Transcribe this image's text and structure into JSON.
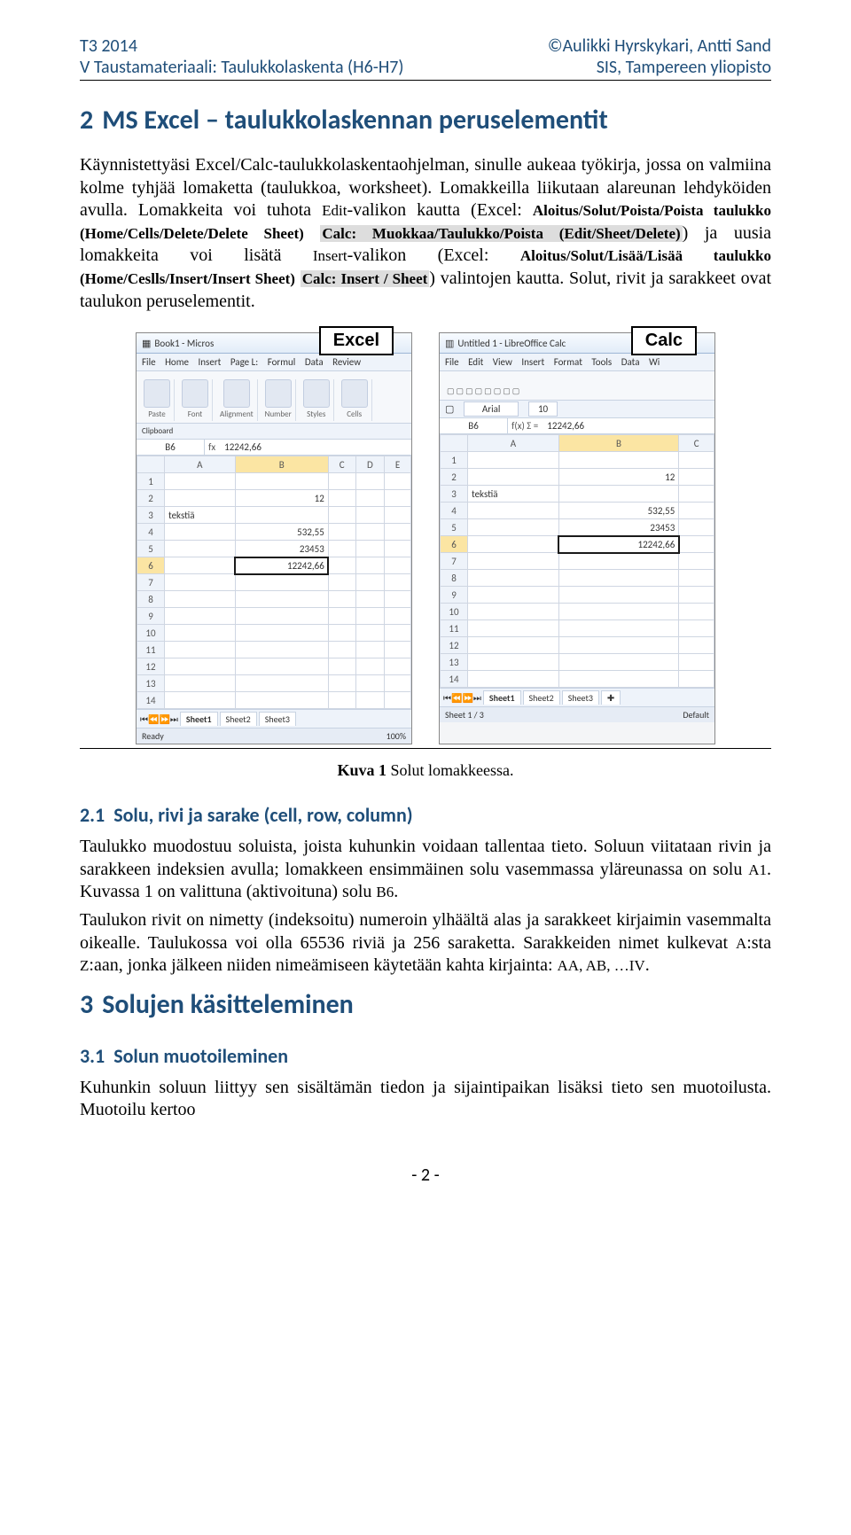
{
  "header": {
    "left1": "T3 2014",
    "left2": "V Taustamateriaali: Taulukkolaskenta (H6-H7)",
    "right1": "©Aulikki Hyrskykari, Antti Sand",
    "right2": "SIS, Tampereen yliopisto"
  },
  "section2": {
    "num": "2",
    "title": "MS Excel – taulukkolaskennan peruselementit",
    "p1a": "Käynnistettyäsi Excel/Calc-taulukkolaskentaohjelman, sinulle aukeaa työkirja, jossa on valmiina kolme tyhjää lomaketta (ta",
    "p1b": "ulukkoa, worksheet",
    "p1c": "). Lomakkeilla liikutaan alareunan lehdyköiden avulla. Lomakkeita voi tuhota ",
    "p1_edit": "Edit",
    "p1d": "-valikon kautta (Excel: ",
    "p1_small1": "Aloitus/Solut/Poista/Poista taulukko (Home/Cells/Delete/Delete Sheet)",
    "p1_hl1": "Calc: Muokkaa/Taulukko/Poista (Edit/Sheet/Delete)",
    "p1e": ") ja uusia lomakkeita voi lisätä ",
    "p1_insert": "Insert",
    "p1f": "-valikon (Excel: ",
    "p1_small2": "Aloitus/Solut/Lisää/Lisää taulukko (Home/Ceslls/Insert/Insert Sheet)",
    "p1_hl2": "Calc: Insert / Sheet",
    "p1g": ") valintojen kautta.  Solut, rivit ja sarakkeet ovat taulukon peruselementit."
  },
  "figure": {
    "excel": {
      "label": "Excel",
      "title": "Book1 - Micros",
      "tabs": [
        "File",
        "Home",
        "Insert",
        "Page L:",
        "Formul",
        "Data",
        "Review"
      ],
      "ribbonGroups": [
        "Paste",
        "Font",
        "Alignment",
        "Number",
        "Styles",
        "Cells"
      ],
      "ribbonFooter": "Clipboard",
      "namebox": "B6",
      "fx": "fx",
      "formula": "12242,66",
      "cols": [
        "",
        "A",
        "B",
        "C",
        "D",
        "E"
      ],
      "rows": [
        {
          "n": "1",
          "A": "",
          "B": "",
          "C": "",
          "D": "",
          "E": ""
        },
        {
          "n": "2",
          "A": "",
          "B": "12",
          "C": "",
          "D": "",
          "E": ""
        },
        {
          "n": "3",
          "A": "tekstiä",
          "B": "",
          "C": "",
          "D": "",
          "E": ""
        },
        {
          "n": "4",
          "A": "",
          "B": "532,55",
          "C": "",
          "D": "",
          "E": ""
        },
        {
          "n": "5",
          "A": "",
          "B": "23453",
          "C": "",
          "D": "",
          "E": ""
        },
        {
          "n": "6",
          "A": "",
          "B": "12242,66",
          "C": "",
          "D": "",
          "E": ""
        },
        {
          "n": "7",
          "A": "",
          "B": "",
          "C": "",
          "D": "",
          "E": ""
        },
        {
          "n": "8",
          "A": "",
          "B": "",
          "C": "",
          "D": "",
          "E": ""
        },
        {
          "n": "9",
          "A": "",
          "B": "",
          "C": "",
          "D": "",
          "E": ""
        },
        {
          "n": "10",
          "A": "",
          "B": "",
          "C": "",
          "D": "",
          "E": ""
        },
        {
          "n": "11",
          "A": "",
          "B": "",
          "C": "",
          "D": "",
          "E": ""
        },
        {
          "n": "12",
          "A": "",
          "B": "",
          "C": "",
          "D": "",
          "E": ""
        },
        {
          "n": "13",
          "A": "",
          "B": "",
          "C": "",
          "D": "",
          "E": ""
        },
        {
          "n": "14",
          "A": "",
          "B": "",
          "C": "",
          "D": "",
          "E": ""
        }
      ],
      "sheetTabs": [
        "Sheet1",
        "Sheet2",
        "Sheet3"
      ],
      "statusLeft": "Ready",
      "statusRight": "100%"
    },
    "calc": {
      "label": "Calc",
      "title": "Untitled 1 - LibreOffice Calc",
      "menu": [
        "File",
        "Edit",
        "View",
        "Insert",
        "Format",
        "Tools",
        "Data",
        "Wi"
      ],
      "font": "Arial",
      "fontsize": "10",
      "namebox": "B6",
      "fx": "f(x)  Σ  =",
      "formula": "12242,66",
      "cols": [
        "",
        "A",
        "B",
        "C"
      ],
      "rows": [
        {
          "n": "1",
          "A": "",
          "B": "",
          "C": ""
        },
        {
          "n": "2",
          "A": "",
          "B": "12",
          "C": ""
        },
        {
          "n": "3",
          "A": "tekstiä",
          "B": "",
          "C": ""
        },
        {
          "n": "4",
          "A": "",
          "B": "532,55",
          "C": ""
        },
        {
          "n": "5",
          "A": "",
          "B": "23453",
          "C": ""
        },
        {
          "n": "6",
          "A": "",
          "B": "12242,66",
          "C": ""
        },
        {
          "n": "7",
          "A": "",
          "B": "",
          "C": ""
        },
        {
          "n": "8",
          "A": "",
          "B": "",
          "C": ""
        },
        {
          "n": "9",
          "A": "",
          "B": "",
          "C": ""
        },
        {
          "n": "10",
          "A": "",
          "B": "",
          "C": ""
        },
        {
          "n": "11",
          "A": "",
          "B": "",
          "C": ""
        },
        {
          "n": "12",
          "A": "",
          "B": "",
          "C": ""
        },
        {
          "n": "13",
          "A": "",
          "B": "",
          "C": ""
        },
        {
          "n": "14",
          "A": "",
          "B": "",
          "C": ""
        }
      ],
      "sheetTabs": [
        "Sheet1",
        "Sheet2",
        "Sheet3"
      ],
      "statusLeft": "Sheet 1 / 3",
      "statusRight": "Default"
    },
    "captionBold": "Kuva  1",
    "captionRest": "  Solut lomakkeessa."
  },
  "section21": {
    "num": "2.1",
    "title": "Solu, rivi ja sarake (cell, row, column)",
    "p1": "Taulukko muodostuu soluista, joista kuhunkin voidaan tallentaa tieto. Soluun viitataan rivin ja sarakkeen indeksien avulla; lomakkeen ensimmäinen solu vasemmassa yläreunassa on solu ",
    "p1_a1": "A1",
    "p1b": ". Kuvassa 1 on valittuna (aktivoituna) solu ",
    "p1_b6": "B6",
    "p1c": ".",
    "p2a": "Taulukon rivit on nimetty (indeksoitu) numeroin ylhäältä alas ja sarakkeet kirjaimin vasemmalta oikealle. Taulukossa voi olla 65536 riviä ja 256 saraketta. Sarakkeiden nimet kulkevat ",
    "p2_a": "A",
    "p2b": ":sta ",
    "p2_z": "Z",
    "p2c": ":aan, jonka jälkeen niiden nimeämiseen käytetään kahta kirjainta: ",
    "p2_aa": "AA, AB, …IV",
    "p2d": "."
  },
  "section3": {
    "num": "3",
    "title": "Solujen käsitteleminen"
  },
  "section31": {
    "num": "3.1",
    "title": "Solun muotoileminen",
    "p": "Kuhunkin soluun liittyy sen sisältämän tiedon ja sijaintipaikan lisäksi tieto sen muotoilusta. Muotoilu kertoo"
  },
  "pagenum": "- 2 -"
}
